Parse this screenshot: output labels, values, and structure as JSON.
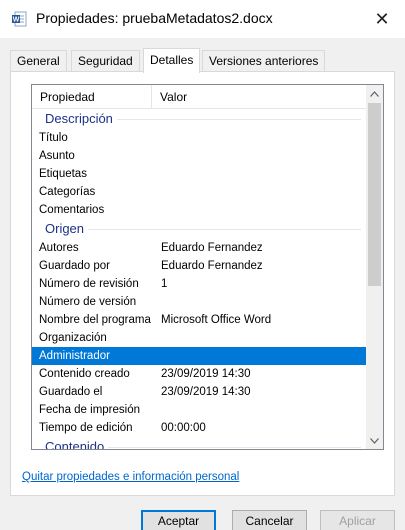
{
  "window": {
    "title": "Propiedades: pruebaMetadatos2.docx",
    "close_glyph": "✕",
    "icon": "word-document-icon"
  },
  "tabs": [
    {
      "label": "General"
    },
    {
      "label": "Seguridad"
    },
    {
      "label": "Detalles",
      "active": true
    },
    {
      "label": "Versiones anteriores"
    }
  ],
  "list": {
    "header": {
      "property": "Propiedad",
      "value": "Valor"
    },
    "groups": {
      "descripcion": "Descripción",
      "origen": "Origen",
      "contenido": "Contenido"
    },
    "descripcion_rows": [
      {
        "k": "Título",
        "v": ""
      },
      {
        "k": "Asunto",
        "v": ""
      },
      {
        "k": "Etiquetas",
        "v": ""
      },
      {
        "k": "Categorías",
        "v": ""
      },
      {
        "k": "Comentarios",
        "v": ""
      }
    ],
    "origen_rows": [
      {
        "k": "Autores",
        "v": "Eduardo Fernandez"
      },
      {
        "k": "Guardado por",
        "v": "Eduardo Fernandez"
      },
      {
        "k": "Número de revisión",
        "v": "1"
      },
      {
        "k": "Número de versión",
        "v": ""
      },
      {
        "k": "Nombre del programa",
        "v": "Microsoft Office Word"
      },
      {
        "k": "Organización",
        "v": ""
      },
      {
        "k": "Administrador",
        "v": "",
        "selected": true
      },
      {
        "k": "Contenido creado",
        "v": "23/09/2019 14:30"
      },
      {
        "k": "Guardado el",
        "v": "23/09/2019 14:30"
      },
      {
        "k": "Fecha de impresión",
        "v": ""
      },
      {
        "k": "Tiempo de edición",
        "v": "00:00:00"
      }
    ]
  },
  "remove_link": "Quitar propiedades e información personal",
  "buttons": {
    "accept": "Aceptar",
    "cancel": "Cancelar",
    "apply": "Aplicar"
  },
  "colors": {
    "selection": "#0078d7",
    "group_header": "#1e3287",
    "link": "#0066cc"
  }
}
